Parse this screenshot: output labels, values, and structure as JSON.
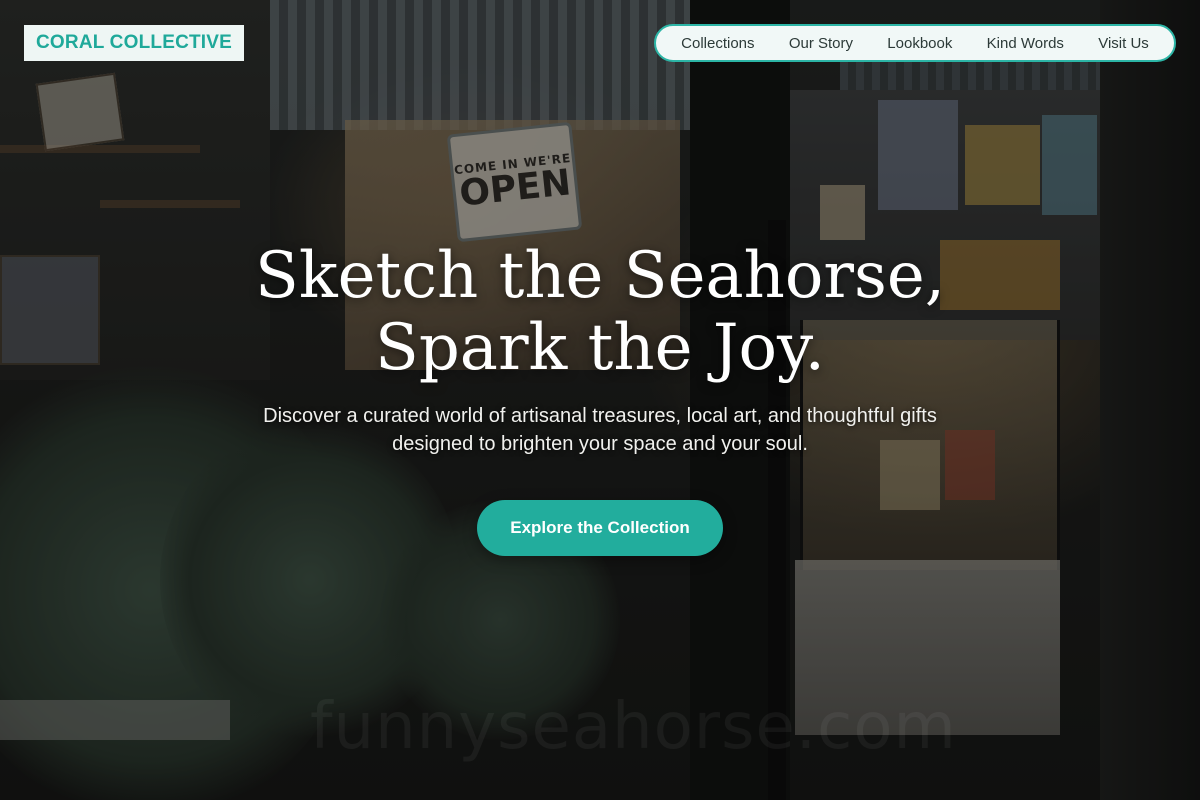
{
  "brand": {
    "name": "CORAL COLLECTIVE"
  },
  "nav": {
    "items": [
      {
        "label": "Collections"
      },
      {
        "label": "Our Story"
      },
      {
        "label": "Lookbook"
      },
      {
        "label": "Kind Words"
      },
      {
        "label": "Visit Us"
      }
    ]
  },
  "hero": {
    "headline_line1": "Sketch the Seahorse,",
    "headline_line2": "Spark the Joy.",
    "subtitle": "Discover a curated world of artisanal treasures, local art, and thoughtful gifts designed to brighten your space and your soul.",
    "cta_label": "Explore the Collection"
  },
  "background": {
    "sign_top": "COME IN WE'RE",
    "sign_bottom": "OPEN",
    "watermark": "funnyseahorse.com"
  },
  "colors": {
    "accent": "#22ad9d",
    "brand_text": "#1fa99a",
    "nav_border": "#2cb5a6"
  }
}
